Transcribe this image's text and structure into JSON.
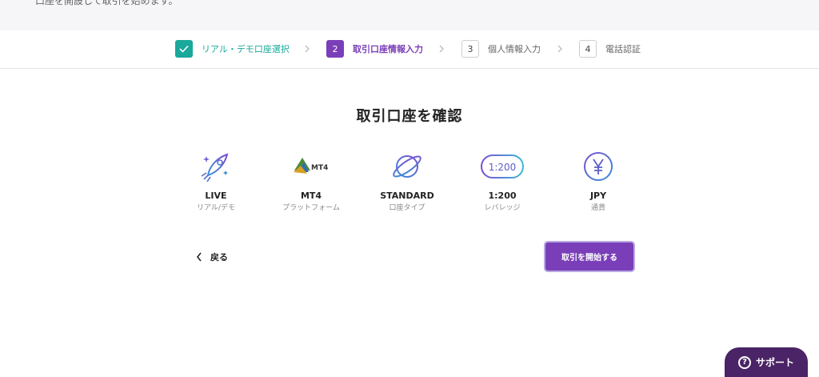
{
  "header": {
    "cut_text": "口座を開設して取引を始めます。"
  },
  "stepper": {
    "steps": [
      {
        "number": "✓",
        "label": "リアル・デモ口座選択",
        "state": "done"
      },
      {
        "number": "2",
        "label": "取引口座情報入力",
        "state": "active"
      },
      {
        "number": "3",
        "label": "個人情報入力",
        "state": "todo"
      },
      {
        "number": "4",
        "label": "電話認証",
        "state": "todo"
      }
    ]
  },
  "main": {
    "title": "取引口座を確認",
    "specs": [
      {
        "value": "LIVE",
        "sub": "リアル/デモ",
        "icon": "rocket-icon"
      },
      {
        "value": "MT4",
        "sub": "プラットフォーム",
        "icon": "mt4-logo",
        "logo_text": "MT4"
      },
      {
        "value": "STANDARD",
        "sub": "口座タイプ",
        "icon": "planet-icon"
      },
      {
        "value": "1:200",
        "sub": "レバレッジ",
        "icon": "leverage-badge",
        "badge_text": "1:200"
      },
      {
        "value": "JPY",
        "sub": "通貨",
        "icon": "yen-icon"
      }
    ],
    "back_label": "戻る",
    "start_label": "取引を開始する"
  },
  "support": {
    "label": "サポート",
    "icon": "help-icon"
  },
  "colors": {
    "accent": "#7a3fb8",
    "done": "#1aa89a",
    "support_bg": "#4a2466"
  }
}
